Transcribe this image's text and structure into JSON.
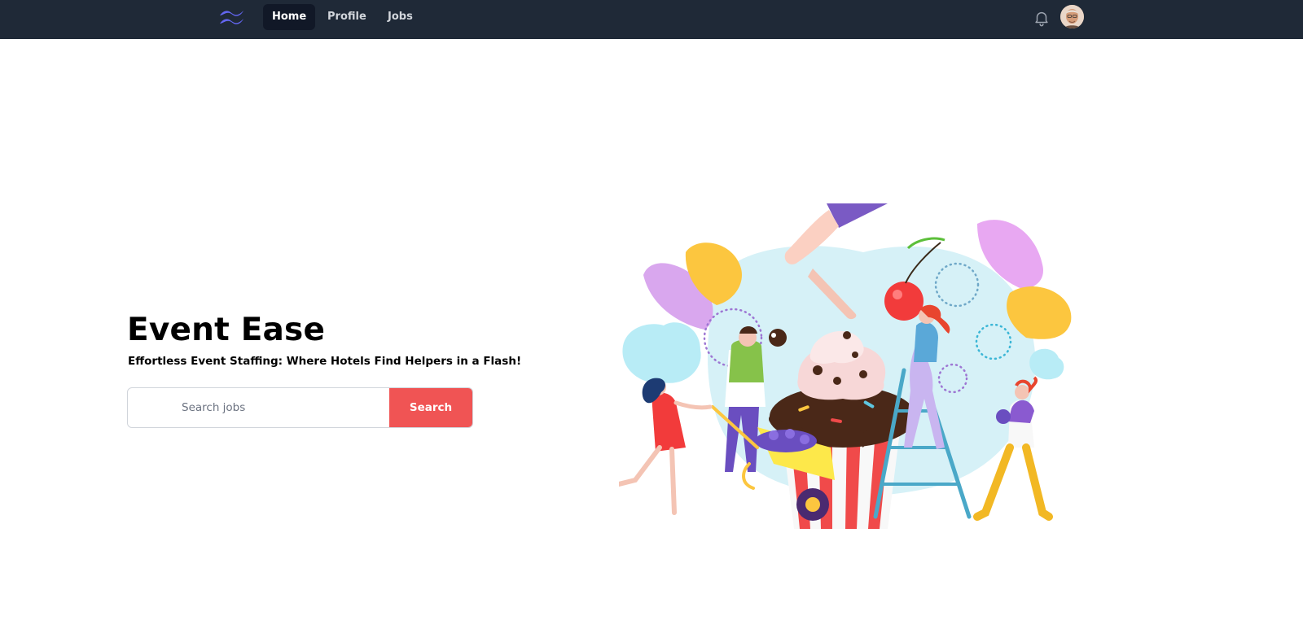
{
  "nav": {
    "links": [
      {
        "label": "Home",
        "active": true
      },
      {
        "label": "Profile",
        "active": false
      },
      {
        "label": "Jobs",
        "active": false
      }
    ],
    "logo_icon": "tailwind-wave-logo",
    "notification_icon": "bell-icon"
  },
  "hero": {
    "title": "Event Ease",
    "subtitle": "Effortless Event Staffing: Where Hotels Find Helpers in a Flash!",
    "search": {
      "placeholder": "Search jobs",
      "value": "",
      "button_label": "Search"
    }
  },
  "colors": {
    "navbar_bg": "#1f2937",
    "nav_active_bg": "#111827",
    "logo": "#6366f1",
    "search_button": "#f05454"
  }
}
